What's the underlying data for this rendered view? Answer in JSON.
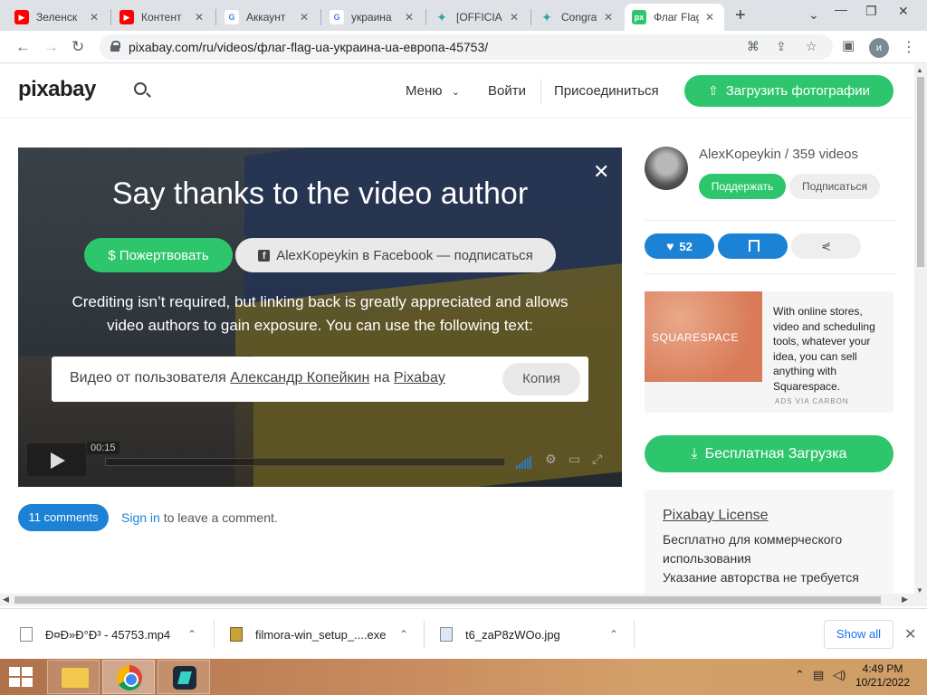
{
  "browser": {
    "tabs": [
      {
        "title": "Зеленск",
        "icon": "youtube-icon"
      },
      {
        "title": "Контент",
        "icon": "youtube-icon"
      },
      {
        "title": "Аккаунт",
        "icon": "google-icon"
      },
      {
        "title": "украина",
        "icon": "google-icon"
      },
      {
        "title": "[OFFICIA",
        "icon": "star-icon"
      },
      {
        "title": "Congrat",
        "icon": "star-icon"
      },
      {
        "title": "Флаг Flag",
        "icon": "pixabay-icon",
        "active": true
      }
    ],
    "url": "pixabay.com/ru/videos/флаг-flag-ua-украина-ua-европа-45753/",
    "profile_initial": "и",
    "favicon_px": "px"
  },
  "header": {
    "logo": "pixabay",
    "menu_label": "Меню",
    "login_label": "Войти",
    "join_label": "Присоединиться",
    "upload_label": "Загрузить фотографии"
  },
  "overlay": {
    "title": "Say thanks to the video author",
    "donate_label": "$ Пожертвовать",
    "facebook_label": "AlexKopeykin в Facebook — подписаться",
    "credit_text": "Crediting isn’t required, but linking back is greatly appreciated and allows video authors to gain exposure. You can use the following text:",
    "attribution_prefix": "Видео от пользователя",
    "attribution_author": "Александр Копейкин",
    "attribution_middle": "на",
    "attribution_site": "Pixabay",
    "copy_label": "Копия"
  },
  "player": {
    "time": "00:15"
  },
  "comments": {
    "count_label": "11 comments",
    "signin_link": "Sign in",
    "signin_rest": "to leave a comment."
  },
  "author": {
    "name_line": "AlexKopeykin / 359 videos",
    "support_label": "Поддержать",
    "subscribe_label": "Подписаться"
  },
  "actions": {
    "likes": "52"
  },
  "ad": {
    "brand": "SQUARESPACE",
    "text": "With online stores, video and scheduling tools, whatever your idea, you can sell anything with Squarespace.",
    "via": "ADS VIA CARBON"
  },
  "download": {
    "label": "Бесплатная Загрузка"
  },
  "license": {
    "title": "Pixabay License",
    "line1": "Бесплатно для коммерческого использования",
    "line2": "Указание авторства не требуется"
  },
  "downloads_shelf": {
    "items": [
      {
        "name": "Ð¤Ð»Ð°Ð³ - 45753.mp4"
      },
      {
        "name": "filmora-win_setup_....exe"
      },
      {
        "name": "t6_zaP8zWOo.jpg"
      }
    ],
    "show_all": "Show all"
  },
  "taskbar": {
    "time": "4:49 PM",
    "date": "10/21/2022"
  },
  "colors": {
    "brand_green": "#2ec66d",
    "link_blue": "#1b82d6"
  }
}
